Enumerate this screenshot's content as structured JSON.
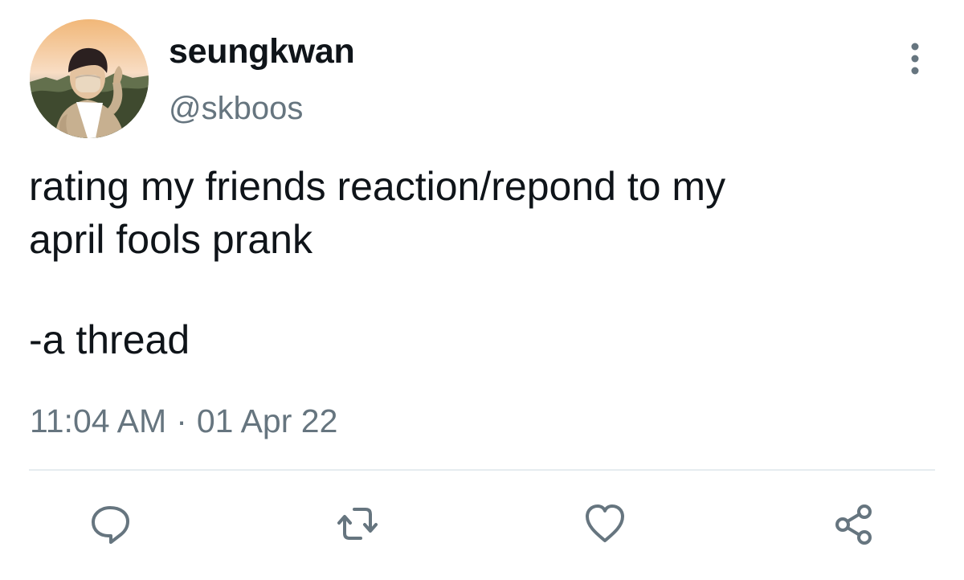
{
  "user": {
    "display_name": "seungkwan",
    "handle": "@skboos",
    "avatar_icon": "profile-photo"
  },
  "tweet": {
    "text": "rating my friends reaction/repond to my\napril fools prank",
    "thread_text": "-a thread",
    "time": "11:04 AM",
    "separator": "·",
    "date": "01 Apr 22"
  },
  "actions": {
    "reply_icon": "reply-icon",
    "retweet_icon": "retweet-icon",
    "like_icon": "heart-icon",
    "share_icon": "share-icon",
    "more_icon": "more-options-icon"
  },
  "colors": {
    "primary_text": "#0f1419",
    "secondary_text": "#66757f",
    "divider": "#e6ecf0"
  }
}
